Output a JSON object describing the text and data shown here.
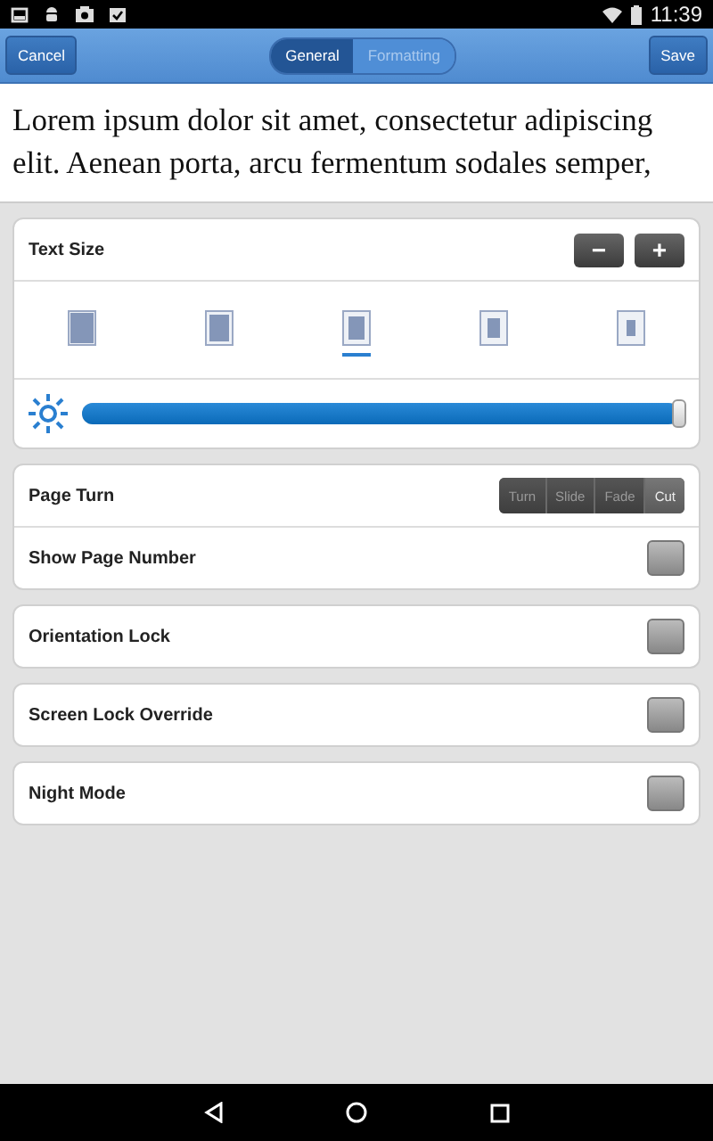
{
  "status_bar": {
    "time": "11:39"
  },
  "toolbar": {
    "cancel": "Cancel",
    "save": "Save",
    "tabs": [
      {
        "label": "General",
        "selected": true
      },
      {
        "label": "Formatting",
        "selected": false
      }
    ]
  },
  "preview": {
    "text": "Lorem ipsum dolor sit amet, consectetur adipiscing elit. Aenean porta, arcu fermentum sodales semper,"
  },
  "text_size": {
    "label": "Text Size",
    "decrease": "−",
    "increase": "+",
    "options": [
      {
        "selected": false
      },
      {
        "selected": false
      },
      {
        "selected": true
      },
      {
        "selected": false
      },
      {
        "selected": false
      }
    ]
  },
  "brightness": {
    "level": 0.99
  },
  "page_turn": {
    "label": "Page Turn",
    "options": [
      {
        "label": "Turn",
        "selected": false
      },
      {
        "label": "Slide",
        "selected": false
      },
      {
        "label": "Fade",
        "selected": false
      },
      {
        "label": "Cut",
        "selected": true
      }
    ]
  },
  "page_settings": [
    {
      "label": "Show Page Number",
      "checked": false
    }
  ],
  "settings": [
    {
      "label": "Orientation Lock",
      "checked": false
    },
    {
      "label": "Screen Lock Override",
      "checked": false
    },
    {
      "label": "Night Mode",
      "checked": false
    }
  ]
}
